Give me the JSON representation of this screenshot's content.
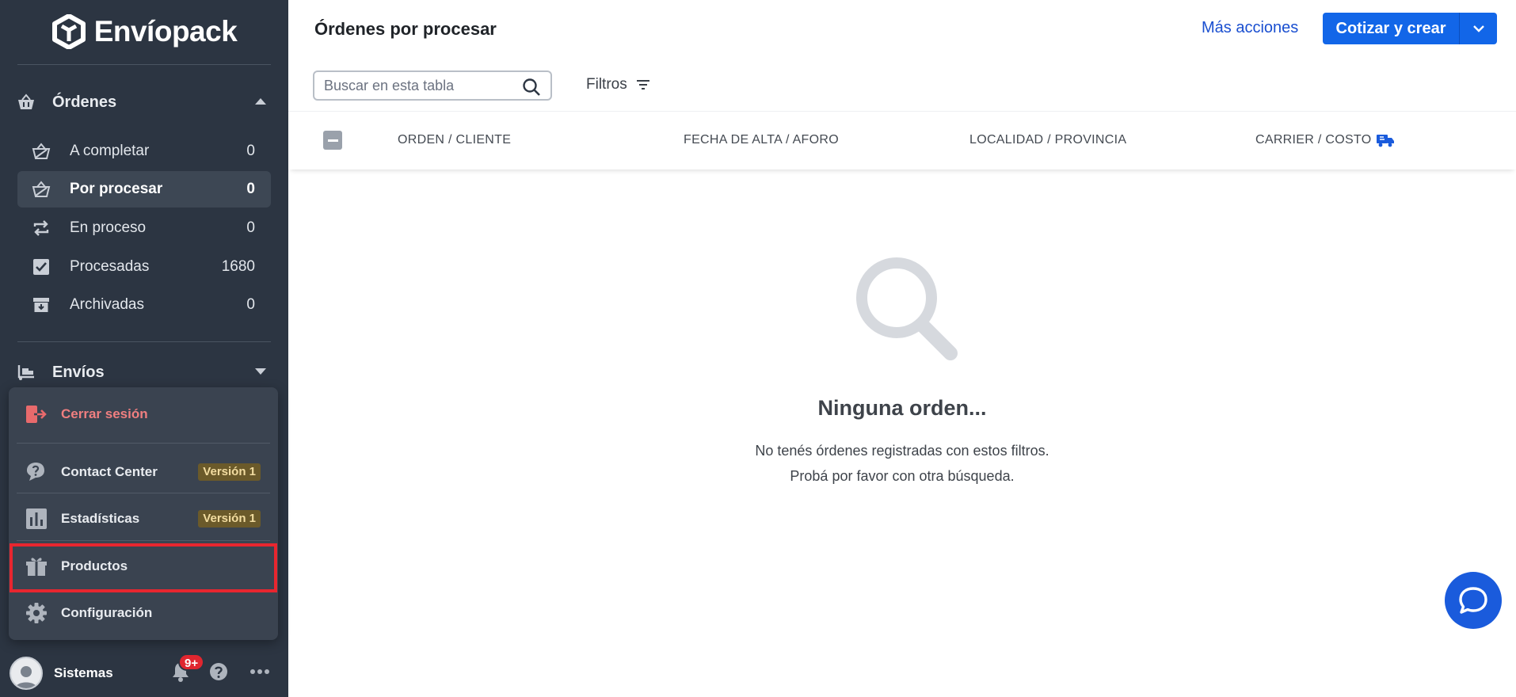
{
  "brand": {
    "name": "Envíopack"
  },
  "sidebar": {
    "orders_section": {
      "label": "Órdenes"
    },
    "orders": [
      {
        "label": "A completar",
        "count": "0"
      },
      {
        "label": "Por procesar",
        "count": "0"
      },
      {
        "label": "En proceso",
        "count": "0"
      },
      {
        "label": "Procesadas",
        "count": "1680"
      },
      {
        "label": "Archivadas",
        "count": "0"
      }
    ],
    "shipments_section": {
      "label": "Envíos"
    }
  },
  "popup": {
    "logout": "Cerrar sesión",
    "contact_center": {
      "label": "Contact Center",
      "badge": "Versión 1"
    },
    "statistics": {
      "label": "Estadísticas",
      "badge": "Versión 1"
    },
    "products": "Productos",
    "settings": "Configuración"
  },
  "footer": {
    "user": "Sistemas",
    "notifications": "9+"
  },
  "header": {
    "title": "Órdenes por procesar",
    "more_actions": "Más acciones",
    "primary_button": "Cotizar y crear"
  },
  "toolbar": {
    "search_placeholder": "Buscar en esta tabla",
    "filters": "Filtros"
  },
  "table": {
    "columns": [
      "ORDEN / CLIENTE",
      "FECHA DE ALTA / AFORO",
      "LOCALIDAD / PROVINCIA",
      "CARRIER / COSTO"
    ]
  },
  "empty_state": {
    "title": "Ninguna orden...",
    "line1": "No tenés órdenes registradas con estos filtros.",
    "line2": "Probá por favor con otra búsqueda."
  },
  "colors": {
    "sidebar_bg": "#2c3542",
    "primary": "#1266e8",
    "link": "#1a4fd0",
    "danger": "#f07f80",
    "highlight": "#e8262f",
    "badge": "#6b5a2a"
  }
}
